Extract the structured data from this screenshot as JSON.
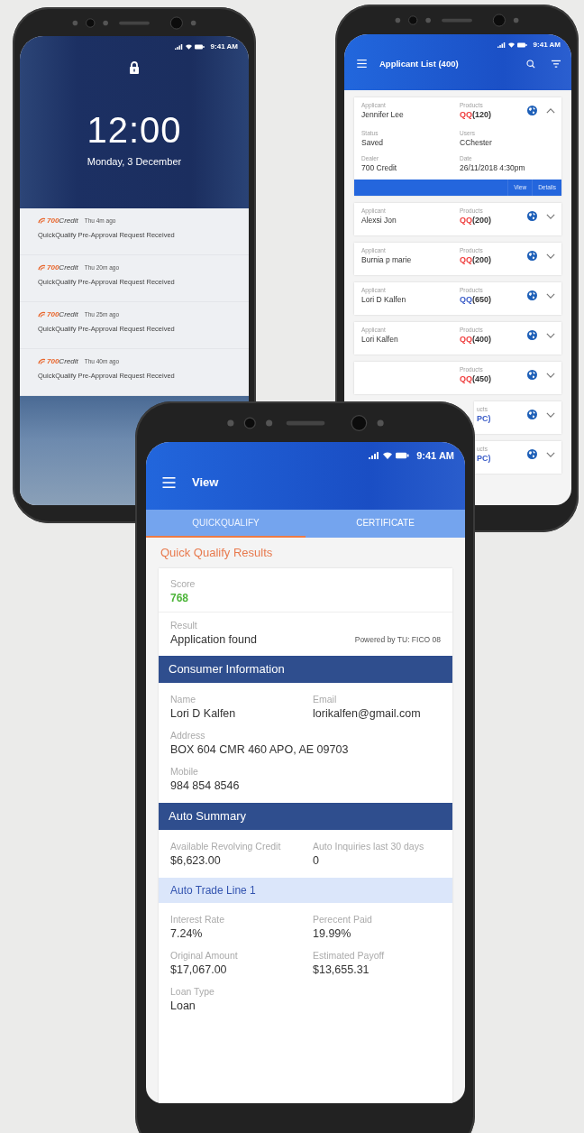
{
  "phones": [
    {
      "kind": "lock",
      "status_bar": {
        "time": "9:41 AM"
      },
      "clock": "12:00",
      "date": "Monday, 3 December",
      "notifications": [
        {
          "brand_number": "700",
          "brand_word": "Credit",
          "time": "Thu 4m ago",
          "message": "QuickQualify Pre-Approval Request Received"
        },
        {
          "brand_number": "700",
          "brand_word": "Credit",
          "time": "Thu 20m ago",
          "message": "QuickQualify Pre-Approval Request Received"
        },
        {
          "brand_number": "700",
          "brand_word": "Credit",
          "time": "Thu 25m ago",
          "message": "QuickQualify Pre-Approval Request Received"
        },
        {
          "brand_number": "700",
          "brand_word": "Credit",
          "time": "Thu 40m ago",
          "message": "QuickQualify Pre-Approval Request Received"
        }
      ]
    },
    {
      "kind": "list",
      "status_bar": {
        "time": "9:41 AM"
      },
      "title": "Applicant List (400)",
      "cards": [
        {
          "kind": "full",
          "expanded": true,
          "applicant_label": "Applicant",
          "applicant": "Jennifer Lee",
          "products_label": "Products",
          "product": [
            {
              "text": "QQ",
              "color": "#ef3b3b"
            },
            {
              "text": "(120)"
            }
          ],
          "details": [
            {
              "label": "Status",
              "value": "Saved"
            },
            {
              "label": "Users",
              "value": "CChester"
            },
            {
              "label": "Dealer",
              "value": "700 Credit"
            },
            {
              "label": "Date",
              "value": "26/11/2018 4:30pm"
            }
          ],
          "actions": [
            "View",
            "Details"
          ]
        },
        {
          "kind": "full",
          "expanded": false,
          "applicant_label": "Applicant",
          "applicant": "Alexsi Jon",
          "products_label": "Products",
          "product": [
            {
              "text": "QQ",
              "color": "#ef3b3b"
            },
            {
              "text": "(200)"
            }
          ]
        },
        {
          "kind": "full",
          "expanded": false,
          "applicant_label": "Applicant",
          "applicant": "Burnia p marie",
          "products_label": "Products",
          "product": [
            {
              "text": "QQ",
              "color": "#ef3b3b"
            },
            {
              "text": "(200)"
            }
          ]
        },
        {
          "kind": "full",
          "expanded": false,
          "applicant_label": "Applicant",
          "applicant": "Lori D Kalfen",
          "products_label": "Products",
          "product": [
            {
              "text": "QQ",
              "color": "#3a5cc8"
            },
            {
              "text": "(650)"
            }
          ]
        },
        {
          "kind": "full",
          "expanded": false,
          "applicant_label": "Applicant",
          "applicant": "Lori Kalfen",
          "products_label": "Products",
          "product": [
            {
              "text": "QQ",
              "color": "#ef3b3b"
            },
            {
              "text": "(400)"
            }
          ]
        },
        {
          "kind": "full",
          "expanded": false,
          "products_label": "Products",
          "product": [
            {
              "text": "QQ",
              "color": "#ef3b3b"
            },
            {
              "text": "(450)"
            }
          ]
        },
        {
          "kind": "covered",
          "expanded": false,
          "products_label": "ucts",
          "product": [
            {
              "text": "PC)",
              "color": "#3a5cc8"
            }
          ]
        },
        {
          "kind": "covered",
          "expanded": false,
          "products_label": "ucts",
          "product": [
            {
              "text": "PC)",
              "color": "#3a5cc8"
            }
          ]
        }
      ]
    },
    {
      "kind": "detail",
      "status_bar": {
        "time": "9:41 AM"
      },
      "title": "View",
      "tabs": [
        {
          "label": "QUICKQUALIFY",
          "selected": true
        },
        {
          "label": "CERTIFICATE",
          "selected": false
        }
      ],
      "heading": "Quick Qualify Results",
      "blocks": [
        {
          "kind": "score",
          "label": "Score",
          "value": "768"
        },
        {
          "kind": "result",
          "label": "Result",
          "value": "Application found",
          "note": "Powered by TU: FICO 08"
        },
        {
          "kind": "band",
          "title": "Consumer Information"
        },
        {
          "kind": "fields",
          "rows": [
            [
              {
                "label": "Name",
                "value": "Lori D Kalfen"
              },
              {
                "label": "Email",
                "value": "lorikalfen@gmail.com"
              }
            ],
            [
              {
                "label": "Address",
                "value": "BOX 604 CMR 460 APO, AE 09703"
              }
            ],
            [
              {
                "label": "Mobile",
                "value": "984 854 8546"
              }
            ]
          ]
        },
        {
          "kind": "band",
          "title": "Auto Summary"
        },
        {
          "kind": "fields",
          "rows": [
            [
              {
                "label": "Available Revolving Credit",
                "value": "$6,623.00"
              },
              {
                "label": "Auto Inquiries last 30 days",
                "value": "0"
              }
            ]
          ]
        },
        {
          "kind": "subband",
          "title": "Auto Trade Line 1"
        },
        {
          "kind": "fields",
          "rows": [
            [
              {
                "label": "Interest Rate",
                "value": "7.24%"
              },
              {
                "label": "Perecent Paid",
                "value": "19.99%"
              }
            ],
            [
              {
                "label": "Original Amount",
                "value": "$17,067.00"
              },
              {
                "label": "Estimated Payoff",
                "value": "$13,655.31"
              }
            ],
            [
              {
                "label": "Loan Type",
                "value": "Loan"
              }
            ]
          ]
        }
      ]
    }
  ]
}
